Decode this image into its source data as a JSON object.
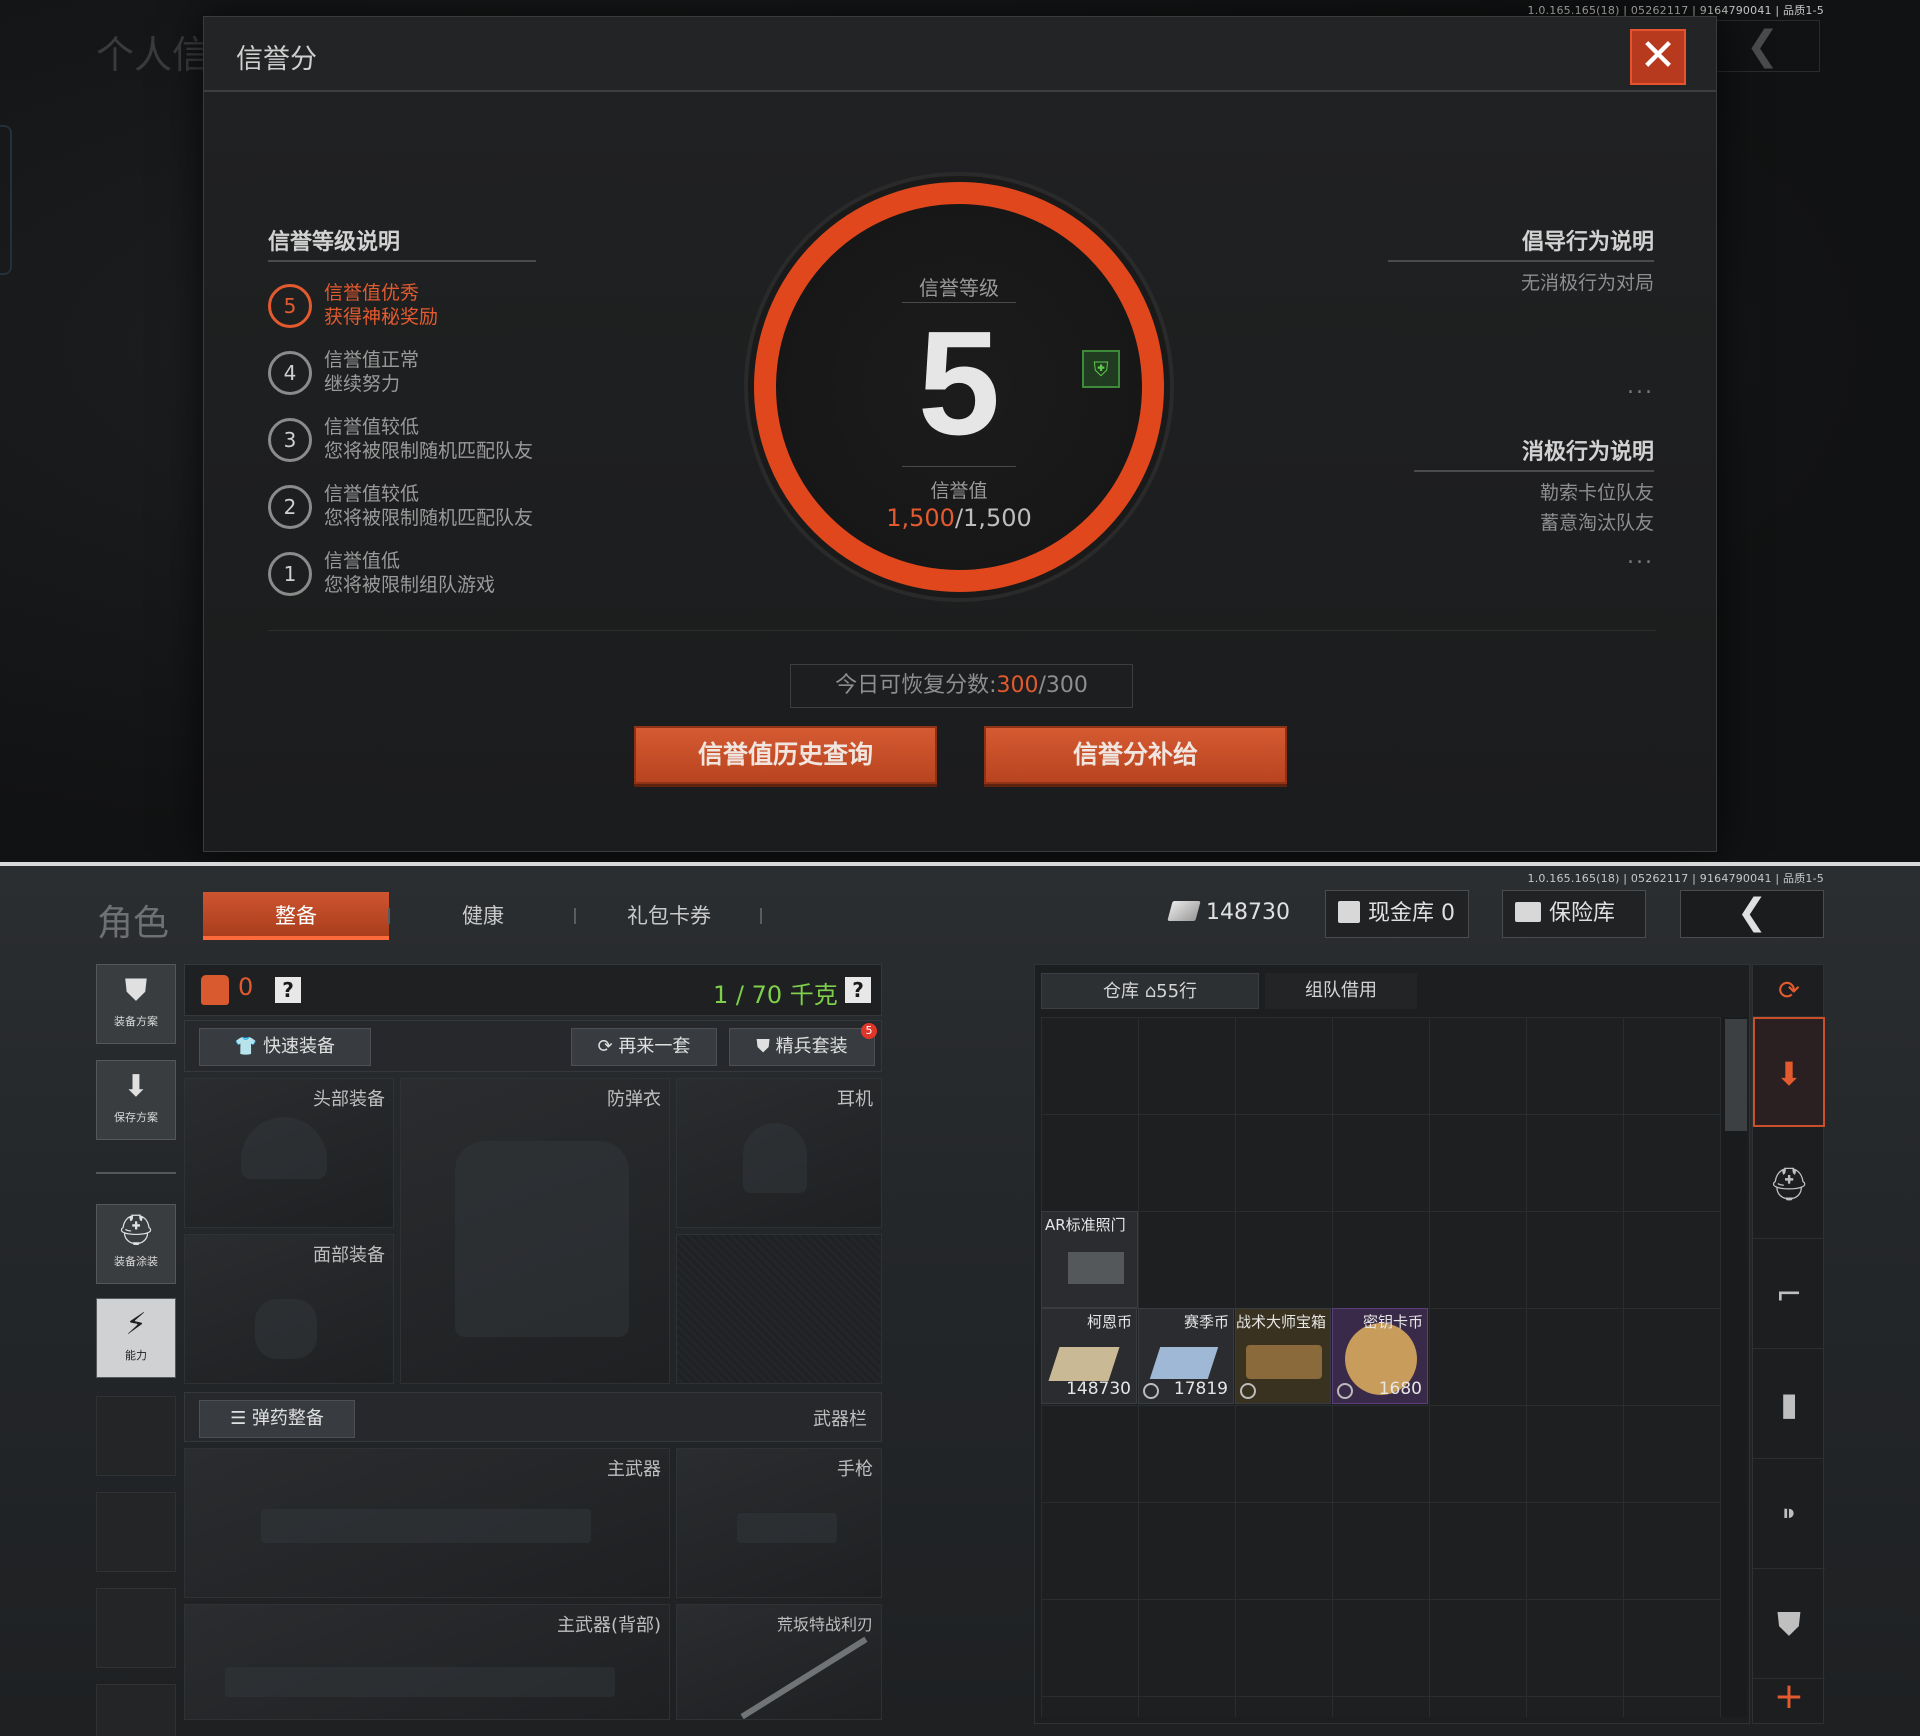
{
  "top": {
    "version": "1.0.165.165(18) | 05262117 | 9164790041 | 品质1-5",
    "bg_title": "个人信",
    "back_glyph": "❮",
    "modal": {
      "title": "信誉分",
      "close_glyph": "✕",
      "levels_title": "信誉等级说明",
      "levels": [
        {
          "num": "5",
          "line1": "信誉值优秀",
          "line2": "获得神秘奖励"
        },
        {
          "num": "4",
          "line1": "信誉值正常",
          "line2": "继续努力"
        },
        {
          "num": "3",
          "line1": "信誉值较低",
          "line2": "您将被限制随机匹配队友"
        },
        {
          "num": "2",
          "line1": "信誉值较低",
          "line2": "您将被限制随机匹配队友"
        },
        {
          "num": "1",
          "line1": "信誉值低",
          "line2": "您将被限制组队游戏"
        }
      ],
      "ring": {
        "level_label": "信誉等级",
        "level": "5",
        "value_label": "信誉值",
        "value_current": "1,500",
        "value_max": "/1,500"
      },
      "encourage_title": "倡导行为说明",
      "encourage_items": [
        "无消极行为对局"
      ],
      "negative_title": "消极行为说明",
      "negative_items": [
        "勒索卡位队友",
        "蓄意淘汰队友"
      ],
      "ellipsis": "...",
      "recover_label": "今日可恢复分数:",
      "recover_current": "300",
      "recover_max": "/300",
      "history_button": "信誉值历史查询",
      "supply_button": "信誉分补给"
    }
  },
  "bottom": {
    "version": "1.0.165.165(18) | 05262117 | 9164790041 | 品质1-5",
    "title": "角色",
    "tabs": [
      "整备",
      "健康",
      "礼包卡券"
    ],
    "currency": "148730",
    "cash_vault": "现金库 0",
    "safe_vault": "保险库",
    "back_glyph": "❮",
    "side_buttons": [
      {
        "icon": "vest-icon",
        "label": "装备方案",
        "glyph": "⛊"
      },
      {
        "icon": "download-icon",
        "label": "保存方案",
        "glyph": "⬇"
      },
      {
        "icon": "helmet-paint-icon",
        "label": "装备涂装",
        "glyph": "⛑"
      },
      {
        "icon": "ability-icon",
        "label": "能力",
        "glyph": "⚡"
      }
    ],
    "equip_count": "0",
    "weight": "1 / 70 千克",
    "help": "?",
    "quick_equip": "快速装备",
    "again": "再来一套",
    "elite": "精兵套装",
    "elite_badge": "5",
    "slots": {
      "head": "头部装备",
      "armor": "防弹衣",
      "headset": "耳机",
      "face": "面部装备",
      "ammo": "弹药整备",
      "weapon_bar": "武器栏",
      "primary": "主武器",
      "pistol": "手枪",
      "primary_back": "主武器(背部)",
      "melee": "荒坂特战利刃"
    },
    "inventory": {
      "tab_warehouse": "仓库",
      "rows": "55行",
      "tab_team": "组队借用",
      "items": [
        {
          "name": "AR标准照门",
          "qty": ""
        },
        {
          "name": "柯恩币",
          "qty": "148730"
        },
        {
          "name": "赛季币",
          "qty": "17819"
        },
        {
          "name": "战术大师宝箱",
          "qty": ""
        },
        {
          "name": "密钥卡币",
          "qty": "1680"
        }
      ]
    },
    "right_sidebar": [
      "stack-refresh-icon",
      "stack-download-icon",
      "helmet-icon",
      "rifle-icon",
      "magazine-icon",
      "bullet-icon",
      "vest-icon",
      "plus-icon"
    ]
  }
}
